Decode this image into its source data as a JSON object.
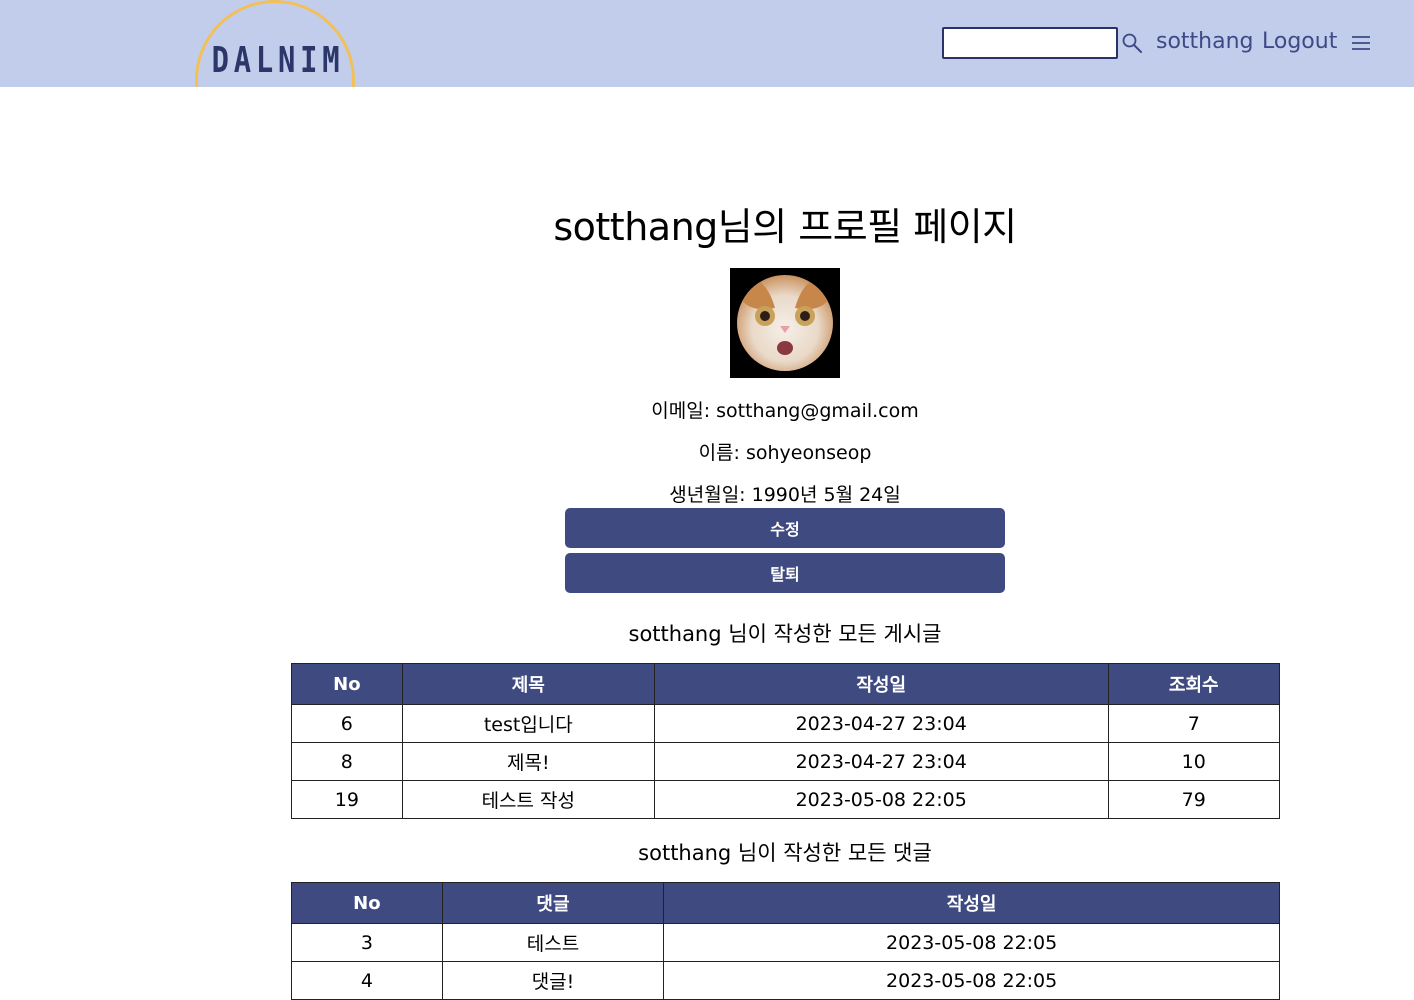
{
  "header": {
    "logo_text": "DALNIM",
    "search": {
      "value": "",
      "placeholder": ""
    },
    "user_link": "sotthang",
    "logout_link": "Logout"
  },
  "profile": {
    "title": "sotthang님의 프로필 페이지",
    "email_line": "이메일: sotthang@gmail.com",
    "name_line": "이름: sohyeonseop",
    "birth_line": "생년월일: 1990년 5월 24일",
    "edit_button": "수정",
    "withdraw_button": "탈퇴"
  },
  "posts": {
    "title": "sotthang 님이 작성한 모든 게시글",
    "columns": [
      "No",
      "제목",
      "작성일",
      "조회수"
    ],
    "rows": [
      [
        "6",
        "test입니다",
        "2023-04-27 23:04",
        "7"
      ],
      [
        "8",
        "제목!",
        "2023-04-27 23:04",
        "10"
      ],
      [
        "19",
        "테스트 작성",
        "2023-05-08 22:05",
        "79"
      ]
    ]
  },
  "comments": {
    "title": "sotthang 님이 작성한 모든 댓글",
    "columns": [
      "No",
      "댓글",
      "작성일"
    ],
    "rows": [
      [
        "3",
        "테스트",
        "2023-05-08 22:05"
      ],
      [
        "4",
        "댓글!",
        "2023-05-08 22:05"
      ]
    ]
  },
  "colors": {
    "header_bg": "#c2cdeb",
    "accent": "#3e4a80",
    "logo_arc": "#f2c05a",
    "nav_text": "#3e4a86"
  },
  "icons": {
    "search": "search-icon",
    "menu": "hamburger-menu-icon"
  }
}
